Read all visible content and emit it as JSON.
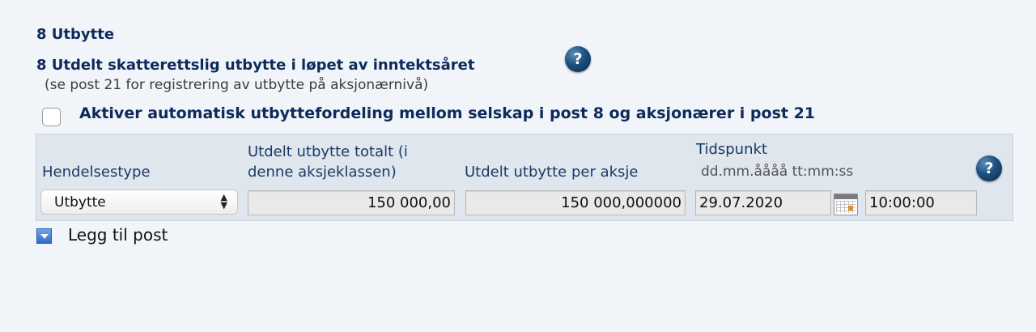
{
  "section": {
    "title": "8 Utbytte",
    "subtitle": "8 Utdelt skatterettslig utbytte i løpet av inntektsåret",
    "note": "(se post 21 for registrering av utbytte på aksjonærnivå)",
    "help_symbol": "?"
  },
  "auto_distribution": {
    "label": "Aktiver automatisk utbyttefordeling mellom selskap i post 8 og aksjonærer i post 21",
    "checked": false
  },
  "table": {
    "columns": {
      "event_type": "Hendelsestype",
      "total_line1": "Utdelt utbytte totalt (i",
      "total_line2": "denne aksjeklassen)",
      "per_share": "Utdelt utbytte per aksje",
      "time": "Tidspunkt",
      "time_format": "dd.mm.åååå tt:mm:ss"
    },
    "row": {
      "event_type": "Utbytte",
      "total": "150 000,00",
      "per_share": "150 000,000000",
      "date": "29.07.2020",
      "time": "10:00:00"
    }
  },
  "add_post_label": "Legg til post",
  "icons": {
    "help": "question-mark-icon",
    "calendar": "calendar-icon",
    "add": "dropdown-arrow-icon",
    "select_arrows": "updown-arrows-icon"
  }
}
